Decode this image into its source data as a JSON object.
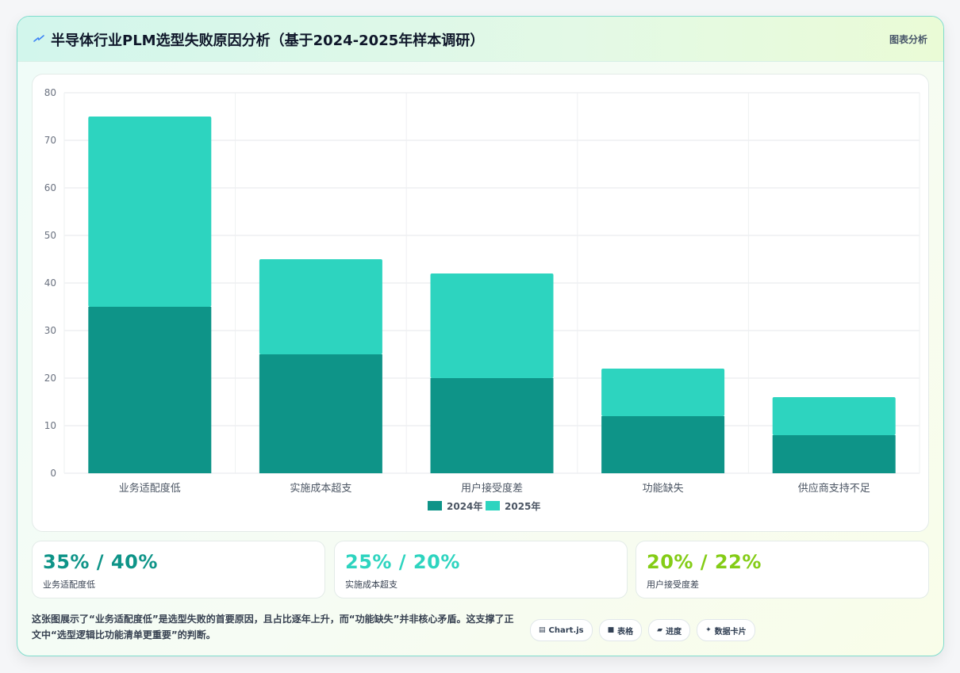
{
  "header": {
    "title": "半导体行业PLM选型失败原因分析（基于2024-2025年样本调研）",
    "tag": "图表分析"
  },
  "colors": {
    "series_2024": "#0e9488",
    "series_2025": "#2dd4bf",
    "stat_1": "#0e9488",
    "stat_2": "#2dd4bf",
    "stat_3": "#84cc16"
  },
  "chart_data": {
    "type": "bar",
    "stacked": true,
    "categories": [
      "业务适配度低",
      "实施成本超支",
      "用户接受度差",
      "功能缺失",
      "供应商支持不足"
    ],
    "series": [
      {
        "name": "2024年",
        "values": [
          35,
          25,
          20,
          12,
          8
        ]
      },
      {
        "name": "2025年",
        "values": [
          40,
          20,
          22,
          10,
          8
        ]
      }
    ],
    "ylim": [
      0,
      80
    ],
    "yticks": [
      0,
      10,
      20,
      30,
      40,
      50,
      60,
      70,
      80
    ],
    "grid": true,
    "legend": "bottom"
  },
  "stats": [
    {
      "value": "35% / 40%",
      "label": "业务适配度低"
    },
    {
      "value": "25% / 20%",
      "label": "实施成本超支"
    },
    {
      "value": "20% / 22%",
      "label": "用户接受度差"
    }
  ],
  "description": "这张图展示了“业务适配度低”是选型失败的首要原因，且占比逐年上升，而“功能缺失”并非核心矛盾。这支撑了正文中“选型逻辑比功能清单更重要”的判断。",
  "tools": [
    {
      "icon": "chart-icon",
      "label": "Chart.js"
    },
    {
      "icon": "table-icon",
      "label": "表格"
    },
    {
      "icon": "progress-icon",
      "label": "进度"
    },
    {
      "icon": "sparkle-icon",
      "label": "数据卡片"
    }
  ]
}
